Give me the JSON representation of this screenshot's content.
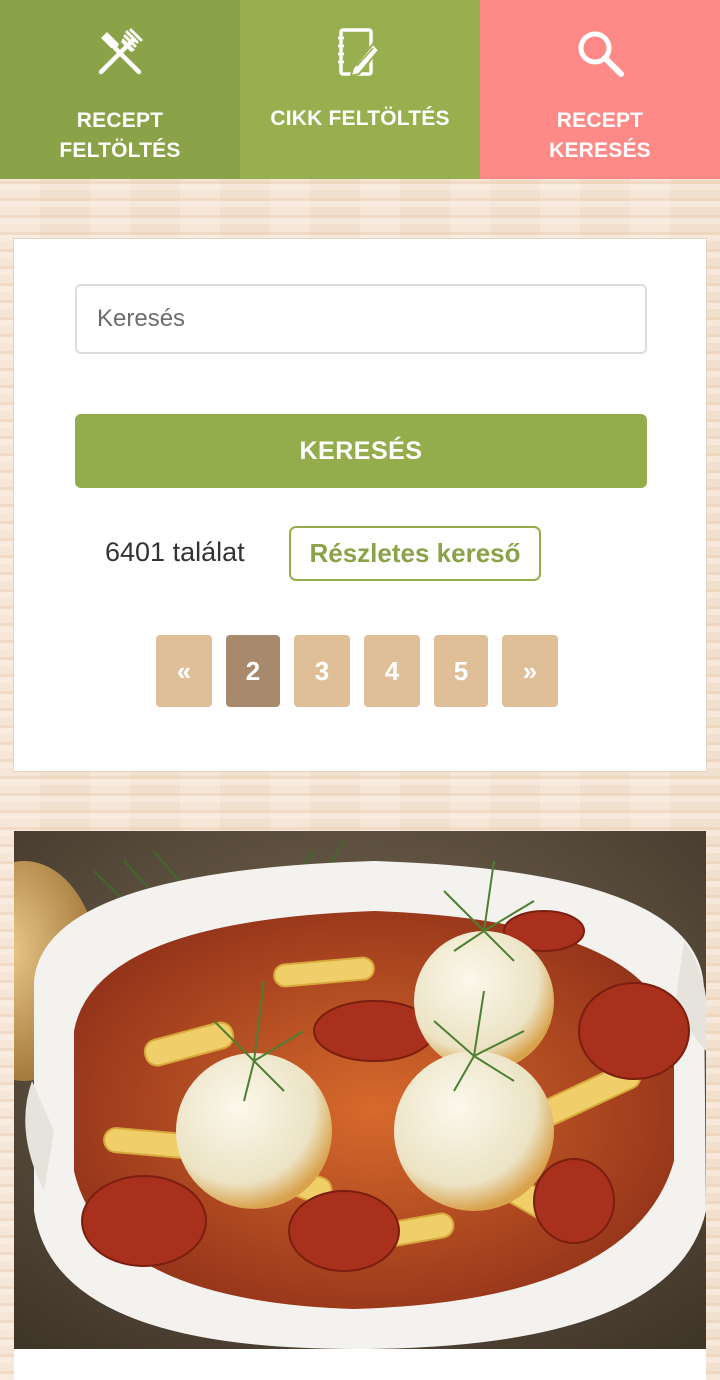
{
  "nav": {
    "items": [
      {
        "label": "RECEPT\nFELTÖLTÉS",
        "icon": "fork-knife-icon",
        "color": "#8aa348"
      },
      {
        "label": "CIKK FELTÖLTÉS",
        "icon": "notepad-pencil-icon",
        "color": "#98af50"
      },
      {
        "label": "RECEPT\nKERESÉS",
        "icon": "search-icon",
        "color": "#fd8a87"
      }
    ]
  },
  "search": {
    "placeholder": "Keresés",
    "value": "",
    "button_label": "KERESÉS",
    "result_count": "6401 találat",
    "advanced_link": "Részletes kereső"
  },
  "pagination": {
    "prev": "«",
    "pages": [
      "2",
      "3",
      "4",
      "5"
    ],
    "active_page": "2",
    "next": "»"
  },
  "colors": {
    "green": "#94ad4c",
    "coral": "#fd8a87",
    "tan": "#dfbf98",
    "tan_active": "#a68a6b"
  }
}
